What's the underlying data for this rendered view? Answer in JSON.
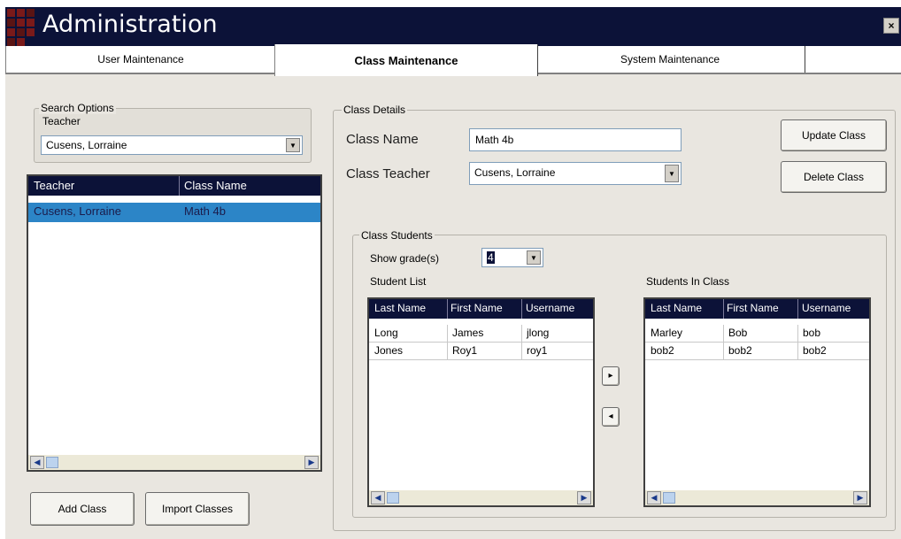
{
  "window": {
    "title": "Administration",
    "close_label": "×"
  },
  "tabs": [
    {
      "label": "User Maintenance",
      "active": false
    },
    {
      "label": "Class Maintenance",
      "active": true
    },
    {
      "label": "System Maintenance",
      "active": false
    }
  ],
  "search": {
    "group_label": "Search Options",
    "teacher_label": "Teacher",
    "teacher_value": "Cusens, Lorraine"
  },
  "class_table": {
    "columns": [
      "Teacher",
      "Class Name"
    ],
    "rows": [
      {
        "teacher": "Cusens, Lorraine",
        "class_name": "Math 4b",
        "selected": true
      }
    ]
  },
  "left_buttons": {
    "add": "Add Class",
    "import": "Import Classes"
  },
  "class_details": {
    "group_label": "Class Details",
    "class_name_label": "Class Name",
    "class_name_value": "Math 4b",
    "class_teacher_label": "Class Teacher",
    "class_teacher_value": "Cusens, Lorraine",
    "update_button": "Update Class",
    "delete_button": "Delete Class"
  },
  "class_students": {
    "group_label": "Class Students",
    "show_grades_label": "Show grade(s)",
    "grade_value": "4",
    "student_list_label": "Student List",
    "students_in_class_label": "Students In Class",
    "columns": [
      "Last Name",
      "First Name",
      "Username"
    ],
    "student_list": [
      [
        "Long",
        "James",
        "jlong"
      ],
      [
        "Jones",
        "Roy1",
        "roy1"
      ]
    ],
    "students_in_class": [
      [
        "Marley",
        "Bob",
        "bob"
      ],
      [
        "bob2",
        "bob2",
        "bob2"
      ]
    ],
    "add_arrow": "▸",
    "remove_arrow": "◂"
  },
  "colors": {
    "title_bar": "#0c1238",
    "selection": "#2c85c7",
    "panel": "#e9e6e0"
  }
}
